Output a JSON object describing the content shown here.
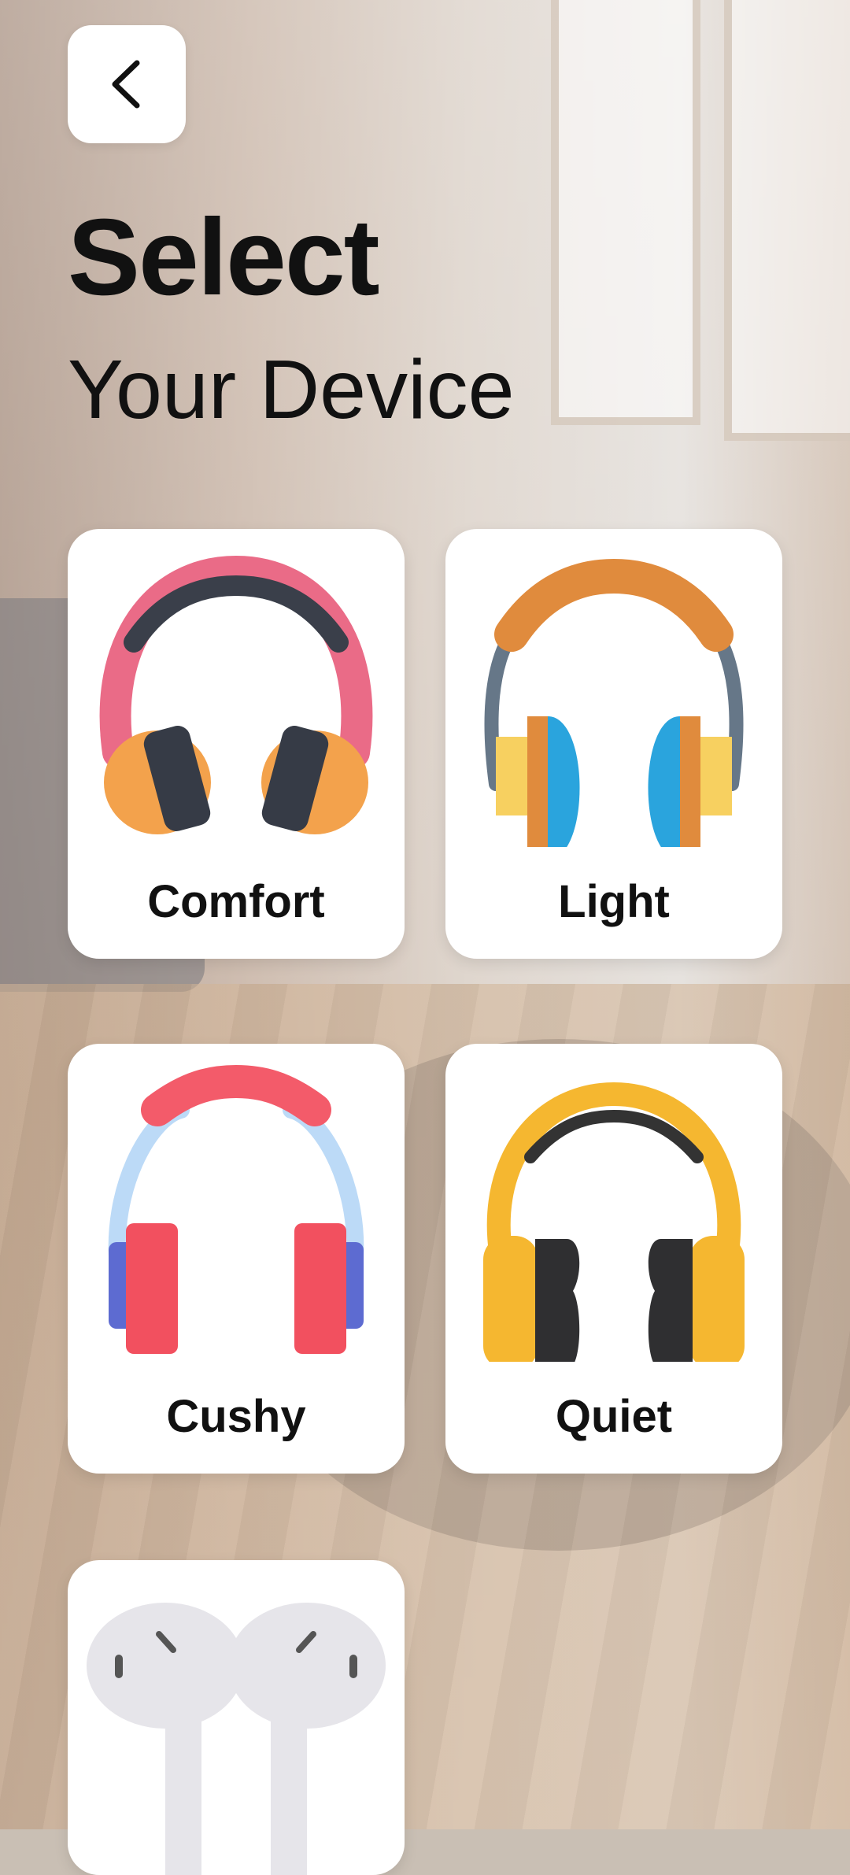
{
  "header": {
    "title": "Select",
    "subtitle": "Your Device"
  },
  "devices": [
    {
      "label": "Comfort",
      "icon": "pink-headphones-icon"
    },
    {
      "label": "Light",
      "icon": "orange-headphones-icon"
    },
    {
      "label": "Cushy",
      "icon": "red-headphones-icon"
    },
    {
      "label": "Quiet",
      "icon": "yellow-headphones-icon"
    },
    {
      "label": "",
      "icon": "earbuds-icon"
    }
  ]
}
